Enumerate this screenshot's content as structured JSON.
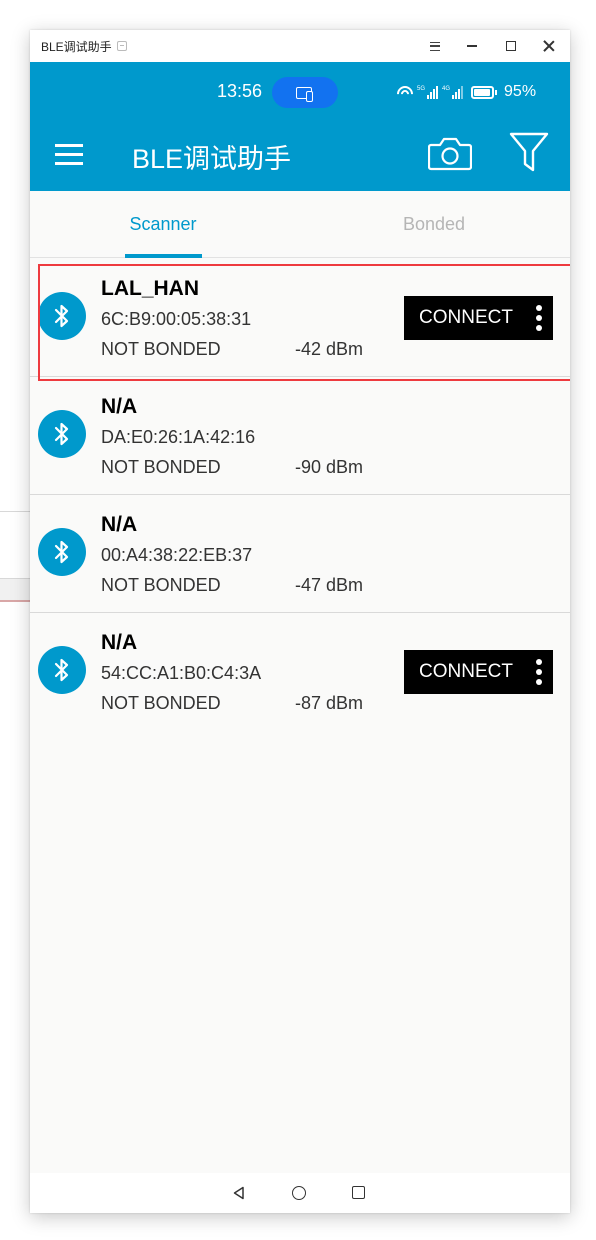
{
  "window": {
    "title": "BLE调试助手",
    "controls": [
      "menu",
      "minimize",
      "maximize",
      "close"
    ]
  },
  "status_bar": {
    "time": "13:56",
    "pill_icon": "screen-cast-icon",
    "network": [
      "wifi",
      "5G signal",
      "4G signal"
    ],
    "battery_percent": "95%",
    "battery_level": 0.95
  },
  "app_bar": {
    "title": "BLE调试助手",
    "menu_icon": "hamburger-icon",
    "actions": [
      "camera-icon",
      "filter-icon"
    ]
  },
  "tabs": [
    {
      "label": "Scanner",
      "active": true
    },
    {
      "label": "Bonded",
      "active": false
    }
  ],
  "devices": [
    {
      "name": "LAL_HAN",
      "mac": "6C:B9:00:05:38:31",
      "bond_state": "NOT BONDED",
      "rssi": "-42 dBm",
      "connect_label": "CONNECT",
      "connectable": true,
      "highlighted": true
    },
    {
      "name": "N/A",
      "mac": "DA:E0:26:1A:42:16",
      "bond_state": "NOT BONDED",
      "rssi": "-90 dBm",
      "connectable": false,
      "highlighted": false
    },
    {
      "name": "N/A",
      "mac": "00:A4:38:22:EB:37",
      "bond_state": "NOT BONDED",
      "rssi": "-47 dBm",
      "connectable": false,
      "highlighted": false
    },
    {
      "name": "N/A",
      "mac": "54:CC:A1:B0:C4:3A",
      "bond_state": "NOT BONDED",
      "rssi": "-87 dBm",
      "connect_label": "CONNECT",
      "connectable": true,
      "highlighted": false
    }
  ],
  "colors": {
    "primary": "#0099cc",
    "pill": "#1272f0",
    "highlight": "#ee3a3f",
    "connect_bg": "#000000",
    "inactive_tab": "#b5b5b5"
  },
  "nav_bar": [
    "back",
    "home",
    "recents"
  ]
}
